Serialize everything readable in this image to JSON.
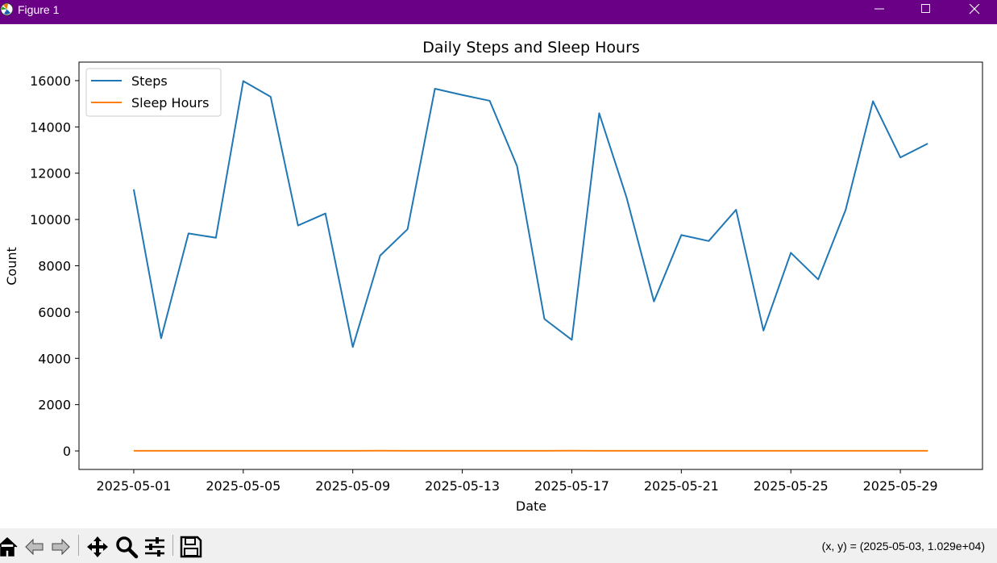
{
  "window": {
    "title": "Figure 1"
  },
  "toolbar": {
    "icons": [
      "home-icon",
      "back-icon",
      "forward-icon",
      "pan-icon",
      "zoom-icon",
      "configure-subplots-icon",
      "save-icon"
    ],
    "coords": "(x, y) = (2025-05-03, 1.029e+04)"
  },
  "colors": {
    "titlebar": "#6a0086",
    "steps": "#1f77b4",
    "sleep": "#ff7f0e"
  },
  "chart_data": {
    "type": "line",
    "title": "Daily Steps and Sleep Hours",
    "xlabel": "Date",
    "ylabel": "Count",
    "x": [
      "2025-05-01",
      "2025-05-02",
      "2025-05-03",
      "2025-05-04",
      "2025-05-05",
      "2025-05-06",
      "2025-05-07",
      "2025-05-08",
      "2025-05-09",
      "2025-05-10",
      "2025-05-11",
      "2025-05-12",
      "2025-05-13",
      "2025-05-14",
      "2025-05-15",
      "2025-05-16",
      "2025-05-17",
      "2025-05-18",
      "2025-05-19",
      "2025-05-20",
      "2025-05-21",
      "2025-05-22",
      "2025-05-23",
      "2025-05-24",
      "2025-05-25",
      "2025-05-26",
      "2025-05-27",
      "2025-05-28",
      "2025-05-29",
      "2025-05-30"
    ],
    "series": [
      {
        "name": "Steps",
        "color": "#1f77b4",
        "values": [
          11300,
          4870,
          9400,
          9210,
          15980,
          15300,
          9740,
          10260,
          4490,
          8440,
          9580,
          15650,
          15380,
          15130,
          12310,
          5700,
          4800,
          14590,
          10950,
          6460,
          9330,
          9070,
          10420,
          5200,
          8560,
          7410,
          10410,
          15110,
          12680,
          13280
        ]
      },
      {
        "name": "Sleep Hours",
        "color": "#ff7f0e",
        "values": [
          7.2,
          6.8,
          7.5,
          8.0,
          6.5,
          7.1,
          7.8,
          6.9,
          7.3,
          8.2,
          7.0,
          6.6,
          7.4,
          7.9,
          6.7,
          7.6,
          8.1,
          7.2,
          6.9,
          7.5,
          7.7,
          6.8,
          7.3,
          8.0,
          7.1,
          6.6,
          7.4,
          7.8,
          7.0,
          7.5
        ]
      }
    ],
    "xticks": [
      "2025-05-01",
      "2025-05-05",
      "2025-05-09",
      "2025-05-13",
      "2025-05-17",
      "2025-05-21",
      "2025-05-25",
      "2025-05-29"
    ],
    "yticks": [
      0,
      2000,
      4000,
      6000,
      8000,
      10000,
      12000,
      14000,
      16000
    ],
    "xlim": [
      "2025-04-29",
      "2025-06-01"
    ],
    "ylim": [
      -800,
      16800
    ],
    "legend": "upper left",
    "grid": false
  }
}
